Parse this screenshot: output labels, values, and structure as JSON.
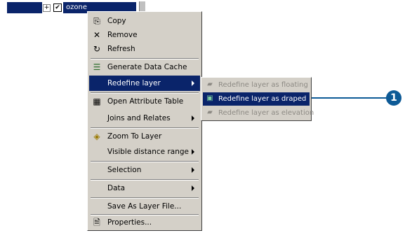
{
  "tree": {
    "layer_name": "ozone",
    "expander": "+",
    "check": "✔"
  },
  "menu": {
    "items": [
      {
        "label": "Copy",
        "icon": "copy-icon"
      },
      {
        "label": "Remove",
        "icon": "remove-icon"
      },
      {
        "label": "Refresh",
        "icon": "refresh-icon"
      },
      {
        "label": "Generate Data Cache",
        "icon": "data-cache-icon"
      },
      {
        "label": "Redefine layer",
        "icon": "",
        "submenu": true
      },
      {
        "label": "Open Attribute Table",
        "icon": "table-icon"
      },
      {
        "label": "Joins and Relates",
        "submenu": true
      },
      {
        "label": "Zoom To Layer",
        "icon": "zoom-to-layer-icon"
      },
      {
        "label": "Visible distance range",
        "submenu": true
      },
      {
        "label": "Selection",
        "submenu": true
      },
      {
        "label": "Data",
        "submenu": true
      },
      {
        "label": "Save As Layer File..."
      },
      {
        "label": "Properties...",
        "icon": "properties-icon"
      }
    ]
  },
  "submenu": {
    "items": [
      {
        "label": "Redefine layer as floating",
        "state": "disabled"
      },
      {
        "label": "Redefine layer as draped",
        "state": "highlighted"
      },
      {
        "label": "Redefine layer as elevation",
        "state": "disabled"
      }
    ]
  },
  "callout": {
    "number": "1"
  },
  "colors": {
    "menu_bg": "#d4d0c8",
    "highlight": "#0a246a",
    "callout": "#0d5a96"
  }
}
